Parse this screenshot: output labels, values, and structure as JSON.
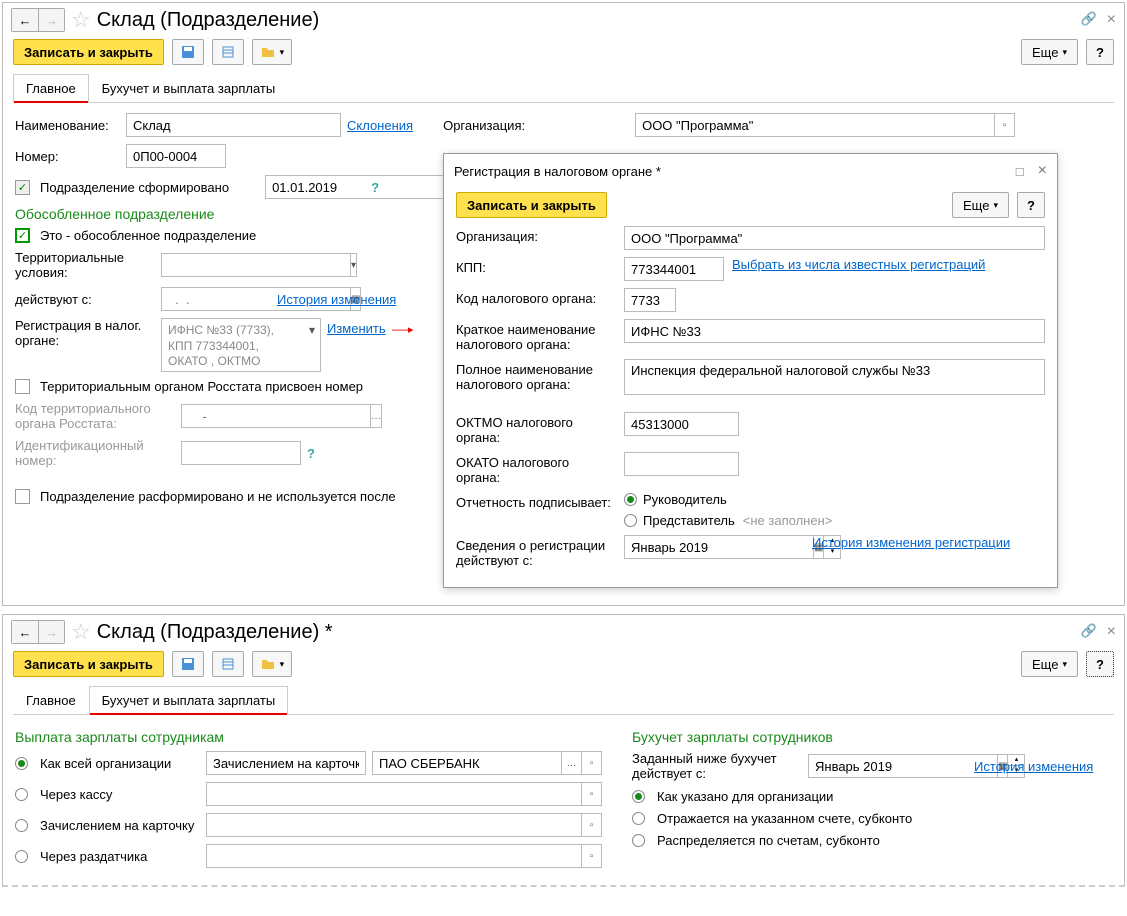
{
  "win1": {
    "title": "Склад (Подразделение)",
    "save_close": "Записать и закрыть",
    "more": "Еще",
    "tab_main": "Главное",
    "tab_payroll": "Бухучет и выплата зарплаты",
    "name_label": "Наименование:",
    "name_value": "Склад",
    "declensions": "Склонения",
    "org_label": "Организация:",
    "org_value": "ООО \"Программа\"",
    "num_label": "Номер:",
    "num_value": "0П00-0004",
    "formed_label": "Подразделение сформировано",
    "formed_date": "01.01.2019",
    "sep_head": "Обособленное подразделение",
    "sep_chk": "Это - обособленное подразделение",
    "terr_label": "Территориальные условия:",
    "valid_from": "действуют с:",
    "valid_placeholder": "  .  .",
    "hist": "История изменения",
    "reg_label": "Регистрация в налог. органе:",
    "reg_box": "ИФНС №33 (7733), КПП 773344001, ОКАТО , ОКТМО",
    "change": "Изменить",
    "rosstat_chk": "Территориальным органом Росстата присвоен номер",
    "rosstat_code_label": "Код территориального органа Росстата:",
    "rosstat_placeholder": "    -",
    "id_label": "Идентификационный номер:",
    "disbanded": "Подразделение расформировано и не используется после"
  },
  "modal": {
    "title": "Регистрация в налоговом органе *",
    "save_close": "Записать и закрыть",
    "more": "Еще",
    "org_label": "Организация:",
    "org_value": "ООО \"Программа\"",
    "kpp_label": "КПП:",
    "kpp_value": "773344001",
    "select_known": "Выбрать из числа известных регистраций",
    "taxcode_label": "Код налогового органа:",
    "taxcode_value": "7733",
    "short_label": "Краткое наименование налогового органа:",
    "short_value": "ИФНС №33",
    "full_label": "Полное наименование налогового органа:",
    "full_value": "Инспекция федеральной налоговой службы №33",
    "oktmo_label": "ОКТМО налогового органа:",
    "oktmo_value": "45313000",
    "okato_label": "ОКАТО налогового органа:",
    "signer_label": "Отчетность подписывает:",
    "signer_opt1": "Руководитель",
    "signer_opt2": "Представитель",
    "not_filled": "<не заполнен>",
    "reginfo_label": "Сведения о регистрации действуют с:",
    "reginfo_value": "Январь 2019",
    "reg_hist": "История изменения регистрации"
  },
  "win2": {
    "title": "Склад (Подразделение) *",
    "save_close": "Записать и закрыть",
    "more": "Еще",
    "tab_main": "Главное",
    "tab_payroll": "Бухучет и выплата зарплаты",
    "pay_head": "Выплата зарплаты сотрудникам",
    "pay_opt1": "Как всей организации",
    "pay_opt1_mode": "Зачислением на карточку",
    "pay_opt1_bank": "ПАО СБЕРБАНК",
    "pay_opt2": "Через кассу",
    "pay_opt3": "Зачислением на карточку",
    "pay_opt4": "Через раздатчика",
    "acc_head": "Бухучет зарплаты сотрудников",
    "acc_set_label": "Заданный ниже бухучет действует с:",
    "acc_set_value": "Январь 2019",
    "acc_hist": "История изменения",
    "acc_opt1": "Как указано для организации",
    "acc_opt2": "Отражается на указанном счете, субконто",
    "acc_opt3": "Распределяется по счетам, субконто"
  }
}
